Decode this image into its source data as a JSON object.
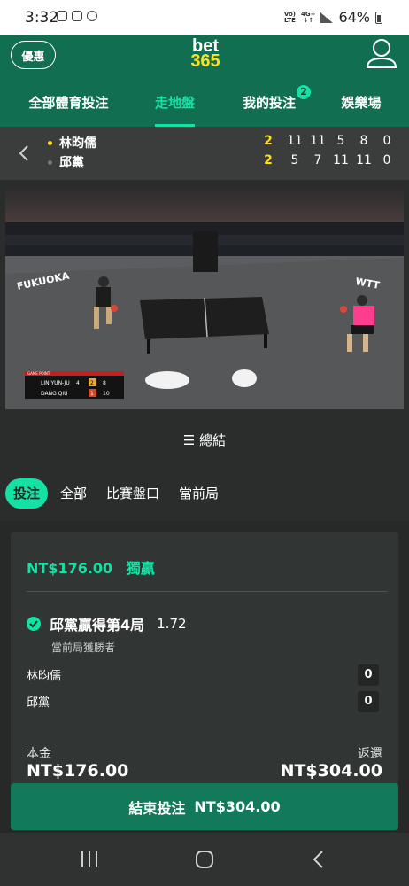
{
  "status_bar": {
    "time": "3:32",
    "network_label": "Vo) 4G+\nLTE ↓↑",
    "battery": "64%"
  },
  "header": {
    "promo_label": "優惠",
    "logo_top": "bet",
    "logo_bottom": "365",
    "nav_tabs": [
      {
        "label": "全部體育投注",
        "active": false
      },
      {
        "label": "走地盤",
        "active": true
      },
      {
        "label": "我的投注",
        "active": false,
        "badge": "2"
      },
      {
        "label": "娛樂場",
        "active": false
      }
    ]
  },
  "scoreboard": {
    "players": [
      {
        "name": "林昀儒",
        "serving": true,
        "sets": "2",
        "games": [
          "11",
          "11",
          "5",
          "8",
          "0"
        ]
      },
      {
        "name": "邱黨",
        "serving": false,
        "sets": "2",
        "games": [
          "5",
          "7",
          "11",
          "11",
          "0"
        ]
      }
    ]
  },
  "video": {
    "caption_game_point": "GAME POINT",
    "caption_p1": "LIN YUN-JU",
    "caption_p1_serve": "4",
    "caption_p1_sets": "2",
    "caption_p1_points": "8",
    "caption_p2": "DANG QIU",
    "caption_p2_sets": "1",
    "caption_p2_points": "10",
    "banner_left": "FUKUOKA",
    "banner_right": "WTT"
  },
  "summary_label": "☰ 總結",
  "filters": [
    {
      "label": "投注",
      "active": true
    },
    {
      "label": "全部",
      "active": false
    },
    {
      "label": "比賽盤口",
      "active": false
    },
    {
      "label": "當前局",
      "active": false
    }
  ],
  "bet": {
    "stake_header": "NT$176.00",
    "bet_type": "獨贏",
    "selection": "邱黨贏得第4局",
    "odds": "1.72",
    "market": "當前局獲勝者",
    "players": [
      {
        "name": "林昀儒",
        "value": "0"
      },
      {
        "name": "邱黨",
        "value": "0"
      }
    ],
    "stake_label": "本金",
    "stake_value": "NT$176.00",
    "return_label": "返還",
    "return_value": "NT$304.00",
    "cashout_label": "結束投注",
    "cashout_value": "NT$304.00"
  },
  "colors": {
    "brand_green": "#126e51",
    "accent": "#14e2a5",
    "yellow": "#ffdf1b"
  }
}
